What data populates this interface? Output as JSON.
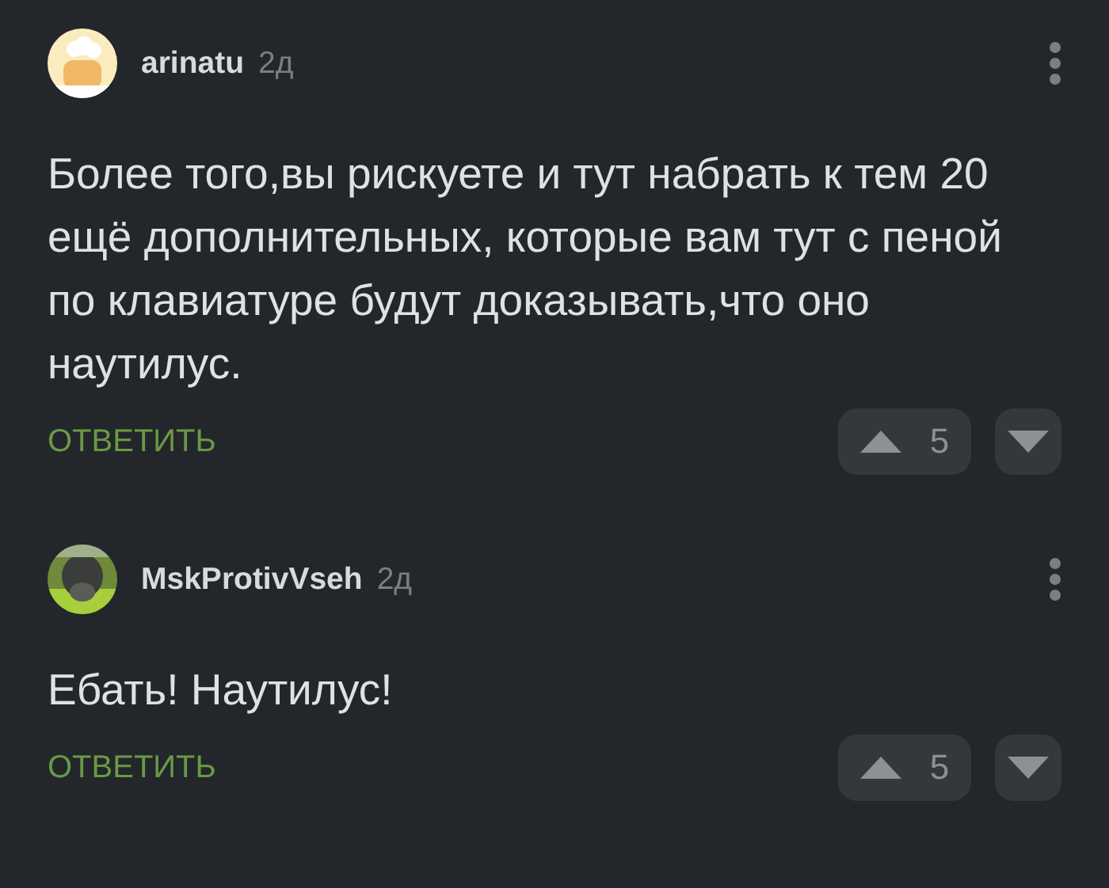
{
  "comments": [
    {
      "author": "arinatu",
      "time": "2д",
      "text": "Более того,вы рискуете и тут набрать к тем 20 ещё дополнительных, которые вам тут с пеной по клавиатуре будут доказывать,что оно наутилус.",
      "reply": "ОТВЕТИТЬ",
      "votes": "5"
    },
    {
      "author": "MskProtivVseh",
      "time": "2д",
      "text": "Ебать! Наутилус!",
      "reply": "ОТВЕТИТЬ",
      "votes": "5"
    }
  ]
}
